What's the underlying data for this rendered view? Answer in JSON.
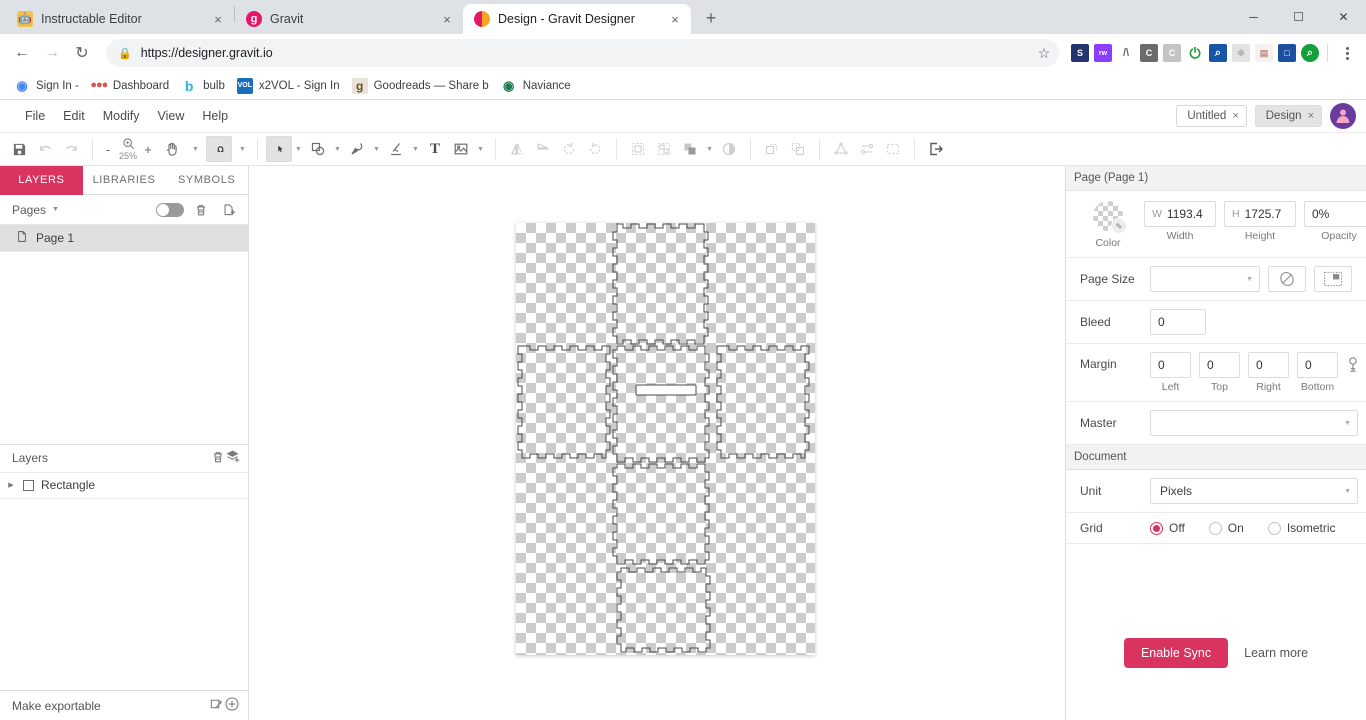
{
  "browser": {
    "tabs": [
      {
        "title": "Instructable Editor",
        "favicon": "instructables-robot-icon",
        "active": false,
        "close_label": "×"
      },
      {
        "title": "Gravit",
        "favicon": "gravit-g-icon",
        "active": false,
        "close_label": "×"
      },
      {
        "title": "Design - Gravit Designer",
        "favicon": "gravit-designer-icon",
        "active": true,
        "close_label": "×"
      }
    ],
    "new_tab_label": "+",
    "window_controls": {
      "minimize": "─",
      "maximize": "☐",
      "close": "✕"
    },
    "nav": {
      "back": "←",
      "forward": "→",
      "reload": "↻"
    },
    "address": {
      "lock": "🔒",
      "url": "https://designer.gravit.io",
      "star": "☆"
    },
    "extensions": [
      {
        "name": "sketchfab-extension-icon",
        "glyph": "S",
        "bg": "#22356f",
        "fg": "#ffffff"
      },
      {
        "name": "rewards-puzzle-extension-icon",
        "glyph": "rw",
        "bg": "#8a3ffc",
        "fg": "#ffffff"
      },
      {
        "name": "grammarly-caret-extension-icon",
        "glyph": "/\\",
        "bg": "transparent",
        "fg": "#6b6b6b"
      },
      {
        "name": "clipboard-c-extension-icon",
        "glyph": "C",
        "bg": "#6b6b6b",
        "fg": "#ffffff"
      },
      {
        "name": "second-c-extension-icon",
        "glyph": "C",
        "bg": "#c4c4c4",
        "fg": "#ffffff"
      },
      {
        "name": "power-toggle-extension-icon",
        "glyph": "⏻",
        "bg": "transparent",
        "fg": "#1f9d3a"
      },
      {
        "name": "search-magnifier-extension-icon",
        "glyph": "⌕",
        "bg": "#1556a8",
        "fg": "#ffffff"
      },
      {
        "name": "dimmed-badge-extension-icon",
        "glyph": "✱",
        "bg": "#e3e3e3",
        "fg": "#b5b5b5"
      },
      {
        "name": "colorful-notes-extension-icon",
        "glyph": "▤",
        "bg": "#f5f2ee",
        "fg": "#c08a8a"
      },
      {
        "name": "book-reader-extension-icon",
        "glyph": "□",
        "bg": "#1d4fa0",
        "fg": "#ffffff"
      },
      {
        "name": "green-search-extension-icon",
        "glyph": "⌕",
        "bg": "#14a03c",
        "fg": "#ffffff"
      }
    ],
    "menu_label": "⋮",
    "bookmarks": [
      {
        "label": "Sign In -",
        "icon_name": "google-account-icon",
        "glyph": "G",
        "bg": "#ffffff",
        "fg": "#4285f4"
      },
      {
        "label": "Dashboard",
        "icon_name": "dashboard-dots-icon",
        "glyph": "•••",
        "bg": "transparent",
        "fg": "#d9534f"
      },
      {
        "label": "bulb",
        "icon_name": "bulb-b-icon",
        "glyph": "b",
        "bg": "transparent",
        "fg": "#29b6d8"
      },
      {
        "label": "x2VOL - Sign In",
        "icon_name": "x2vol-icon",
        "glyph": "VOL",
        "bg": "#1b6fba",
        "fg": "#ffffff"
      },
      {
        "label": "Goodreads — Share b",
        "icon_name": "goodreads-g-icon",
        "glyph": "g",
        "bg": "#e9e3d7",
        "fg": "#6b4f2a"
      },
      {
        "label": "Naviance",
        "icon_name": "naviance-icon",
        "glyph": "◉",
        "bg": "transparent",
        "fg": "#1f7a4d"
      }
    ]
  },
  "app": {
    "menu": [
      "File",
      "Edit",
      "Modify",
      "View",
      "Help"
    ],
    "doc_tabs": [
      {
        "label": "Untitled",
        "close": "×",
        "active": false
      },
      {
        "label": "Design",
        "close": "×",
        "active": true
      }
    ],
    "avatar_name": "user-avatar",
    "toolbar": {
      "save": {
        "name": "save-icon",
        "glyph": "💾"
      },
      "undo": {
        "name": "undo-icon",
        "glyph": "↶"
      },
      "redo": {
        "name": "redo-icon",
        "glyph": "↷"
      },
      "zoom_out": "-",
      "zoom_in": "+",
      "zoom_level": "25%",
      "zoom_icon_name": "zoom-magnifier-icon",
      "hand": {
        "name": "hand-tool-icon",
        "glyph": "✋"
      },
      "magnet": {
        "name": "snap-magnet-icon",
        "glyph": "∩"
      },
      "pointer": {
        "name": "select-arrow-tool-icon",
        "glyph": "➤"
      },
      "shape": {
        "name": "shape-tool-icon",
        "glyph": "▢"
      },
      "pen": {
        "name": "pen-tool-icon",
        "glyph": "✒"
      },
      "knife": {
        "name": "knife-slice-tool-icon",
        "glyph": "⁄"
      },
      "text": {
        "name": "text-tool-icon",
        "glyph": "T"
      },
      "image": {
        "name": "image-tool-icon",
        "glyph": "⛰"
      },
      "flip_h": {
        "name": "flip-horizontal-icon",
        "glyph": "◥"
      },
      "flip_v": {
        "name": "flip-vertical-icon",
        "glyph": "◀"
      },
      "rotate_ccw": {
        "name": "rotate-left-icon",
        "glyph": "↺"
      },
      "rotate_cw": {
        "name": "rotate-right-icon",
        "glyph": "↻"
      },
      "group": {
        "name": "group-icon",
        "glyph": "⬚"
      },
      "ungroup": {
        "name": "ungroup-icon",
        "glyph": "⬚"
      },
      "boolean": {
        "name": "boolean-ops-icon",
        "glyph": "❐"
      },
      "mask": {
        "name": "mask-icon",
        "glyph": "◑"
      },
      "bring_front": {
        "name": "bring-to-front-icon",
        "glyph": "❐"
      },
      "send_back": {
        "name": "send-to-back-icon",
        "glyph": "❐"
      },
      "path_ops": {
        "name": "path-operations-icon",
        "glyph": "△"
      },
      "distribute": {
        "name": "distribute-icon",
        "glyph": "≡"
      },
      "slice": {
        "name": "slice-select-icon",
        "glyph": "⬚"
      },
      "export": {
        "name": "export-icon",
        "glyph": "⇥"
      }
    },
    "left_panel": {
      "tabs": [
        {
          "label": "LAYERS",
          "active": true
        },
        {
          "label": "LIBRARIES",
          "active": false
        },
        {
          "label": "SYMBOLS",
          "active": false
        }
      ],
      "pages_header": {
        "label": "Pages",
        "caret_name": "chevron-down-icon",
        "toggle_name": "pages-visibility-toggle",
        "delete_name": "delete-page-icon",
        "add_name": "add-page-icon"
      },
      "pages": [
        {
          "label": "Page 1",
          "selected": true,
          "icon_name": "page-document-icon"
        }
      ],
      "layers_header": {
        "label": "Layers",
        "delete_name": "delete-layer-icon",
        "add_name": "add-layer-icon"
      },
      "layers": [
        {
          "label": "Rectangle",
          "expand": "▶",
          "icon_name": "rectangle-shape-icon"
        }
      ],
      "footer": {
        "label": "Make exportable",
        "slice_name": "export-slice-icon",
        "add_name": "add-export-icon"
      }
    },
    "right_panel": {
      "title": "Page (Page 1)",
      "color": {
        "caption": "Color",
        "swatch_name": "page-color-swatch",
        "eyedropper_name": "eyedropper-icon"
      },
      "width": {
        "prefix": "W",
        "value": "1193.4",
        "caption": "Width"
      },
      "height": {
        "prefix": "H",
        "value": "1725.7",
        "caption": "Height"
      },
      "opacity": {
        "value": "0%",
        "caption": "Opacity"
      },
      "page_size": {
        "label": "Page Size",
        "value": "",
        "placeholder": "",
        "orientation_icon_name": "page-orientation-icon",
        "fit_icon_name": "fit-page-icon"
      },
      "bleed": {
        "label": "Bleed",
        "value": "0"
      },
      "margin": {
        "label": "Margin",
        "values": [
          "0",
          "0",
          "0",
          "0"
        ],
        "captions": [
          "Left",
          "Top",
          "Right",
          "Bottom"
        ],
        "link_icon_name": "link-margins-icon"
      },
      "master": {
        "label": "Master",
        "value": ""
      },
      "document_section": {
        "title": "Document",
        "unit": {
          "label": "Unit",
          "value": "Pixels"
        },
        "grid": {
          "label": "Grid",
          "options": [
            {
              "label": "Off",
              "selected": true
            },
            {
              "label": "On",
              "selected": false
            },
            {
              "label": "Isometric",
              "selected": false
            }
          ]
        }
      },
      "sync": {
        "button_label": "Enable Sync",
        "link_label": "Learn more",
        "accent": "#d9335f"
      }
    },
    "canvas": {
      "artwork_name": "box-joint-cube-net-path",
      "zoom": "25%"
    }
  },
  "colors": {
    "accent": "#d9335f",
    "panel_border": "#dcdcdc",
    "toolbar_icon": "#666666",
    "browser_tabstrip": "#dee1e6"
  }
}
